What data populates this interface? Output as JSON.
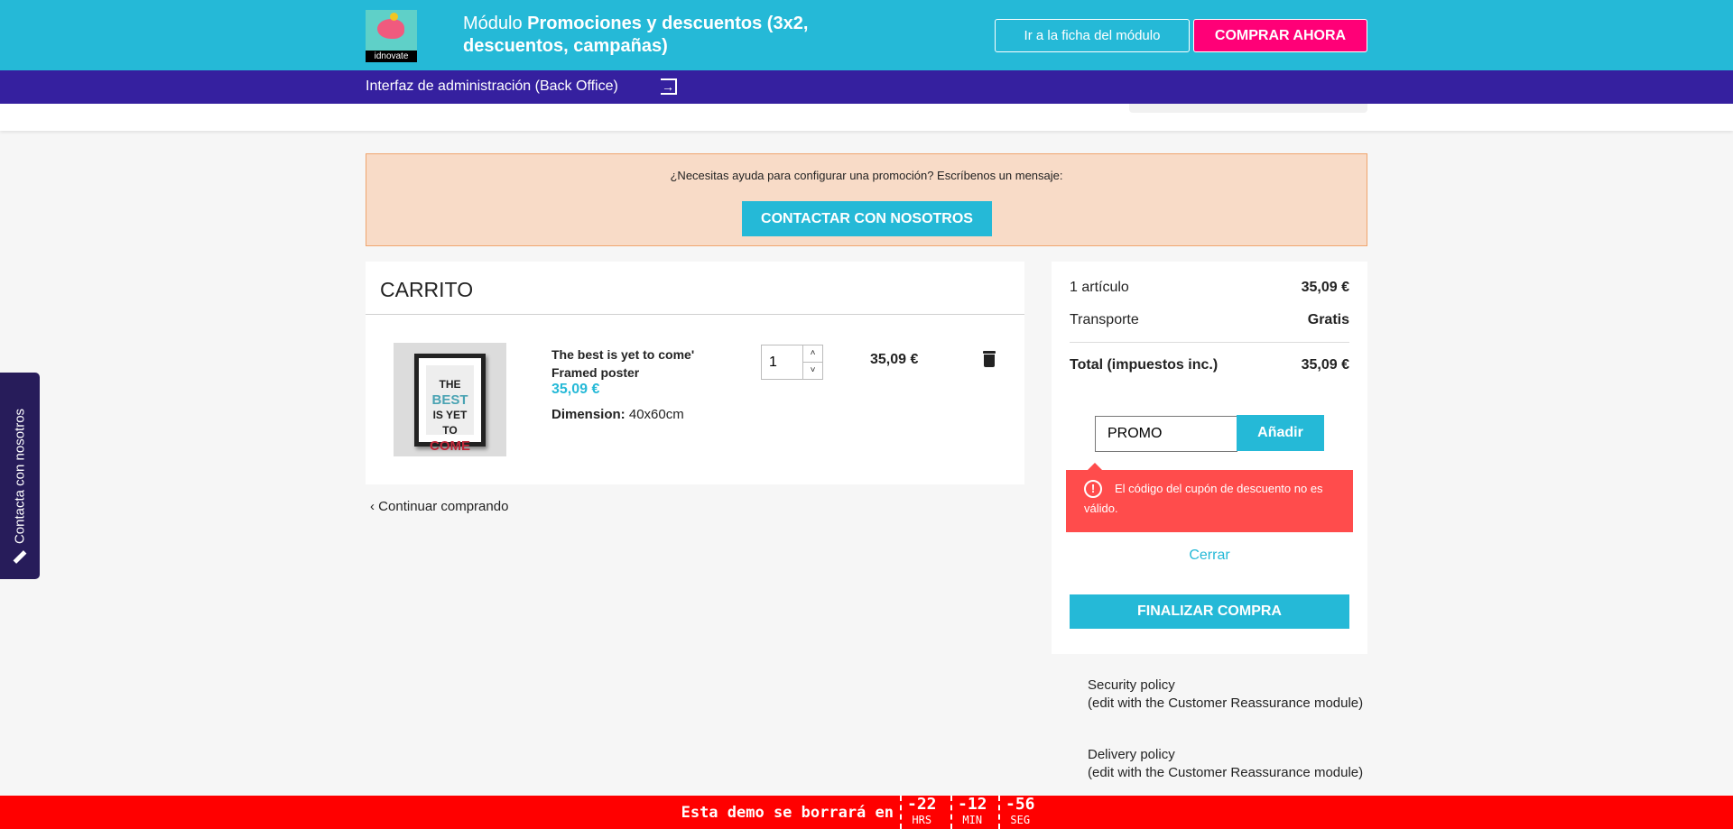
{
  "header": {
    "logo_text": "idnovate",
    "title_prefix": "Módulo",
    "title_bold": "Promociones y descuentos (3x2, descuentos, campañas)",
    "module_button": "Ir a la ficha del módulo",
    "buy_button": "COMPRAR AHORA"
  },
  "admin_bar": {
    "label": "Interfaz de administración (Back Office)"
  },
  "help": {
    "text": "¿Necesitas ayuda para configurar una promoción? Escríbenos un mensaje:",
    "button": "CONTACTAR CON NOSOTROS"
  },
  "cart": {
    "title": "CARRITO",
    "item": {
      "name": "The best is yet to come' Framed poster",
      "price": "35,09 €",
      "dimension_label": "Dimension:",
      "dimension_value": "40x60cm",
      "quantity": "1",
      "total": "35,09 €",
      "art": [
        "THE",
        "BEST",
        "IS YET TO",
        "COME"
      ]
    },
    "continue": "Continuar comprando"
  },
  "summary": {
    "items_label": "1 artículo",
    "items_value": "35,09 €",
    "shipping_label": "Transporte",
    "shipping_value": "Gratis",
    "total_label": "Total (impuestos inc.)",
    "total_value": "35,09 €",
    "coupon_value": "PROMO",
    "add_button": "Añadir",
    "error": "El código del cupón de descuento no es válido.",
    "close": "Cerrar",
    "checkout": "FINALIZAR COMPRA"
  },
  "reassurance": [
    {
      "title": "Security policy",
      "note": "(edit with the Customer Reassurance module)"
    },
    {
      "title": "Delivery policy",
      "note": "(edit with the Customer Reassurance module)"
    }
  ],
  "side_tab": {
    "label": "Contacta con nosotros"
  },
  "demo_bar": {
    "label": "Esta demo se borrará en",
    "hours": "-22",
    "hours_unit": "HRS",
    "minutes": "-12",
    "minutes_unit": "MIN",
    "seconds": "-56",
    "seconds_unit": "SEG"
  }
}
